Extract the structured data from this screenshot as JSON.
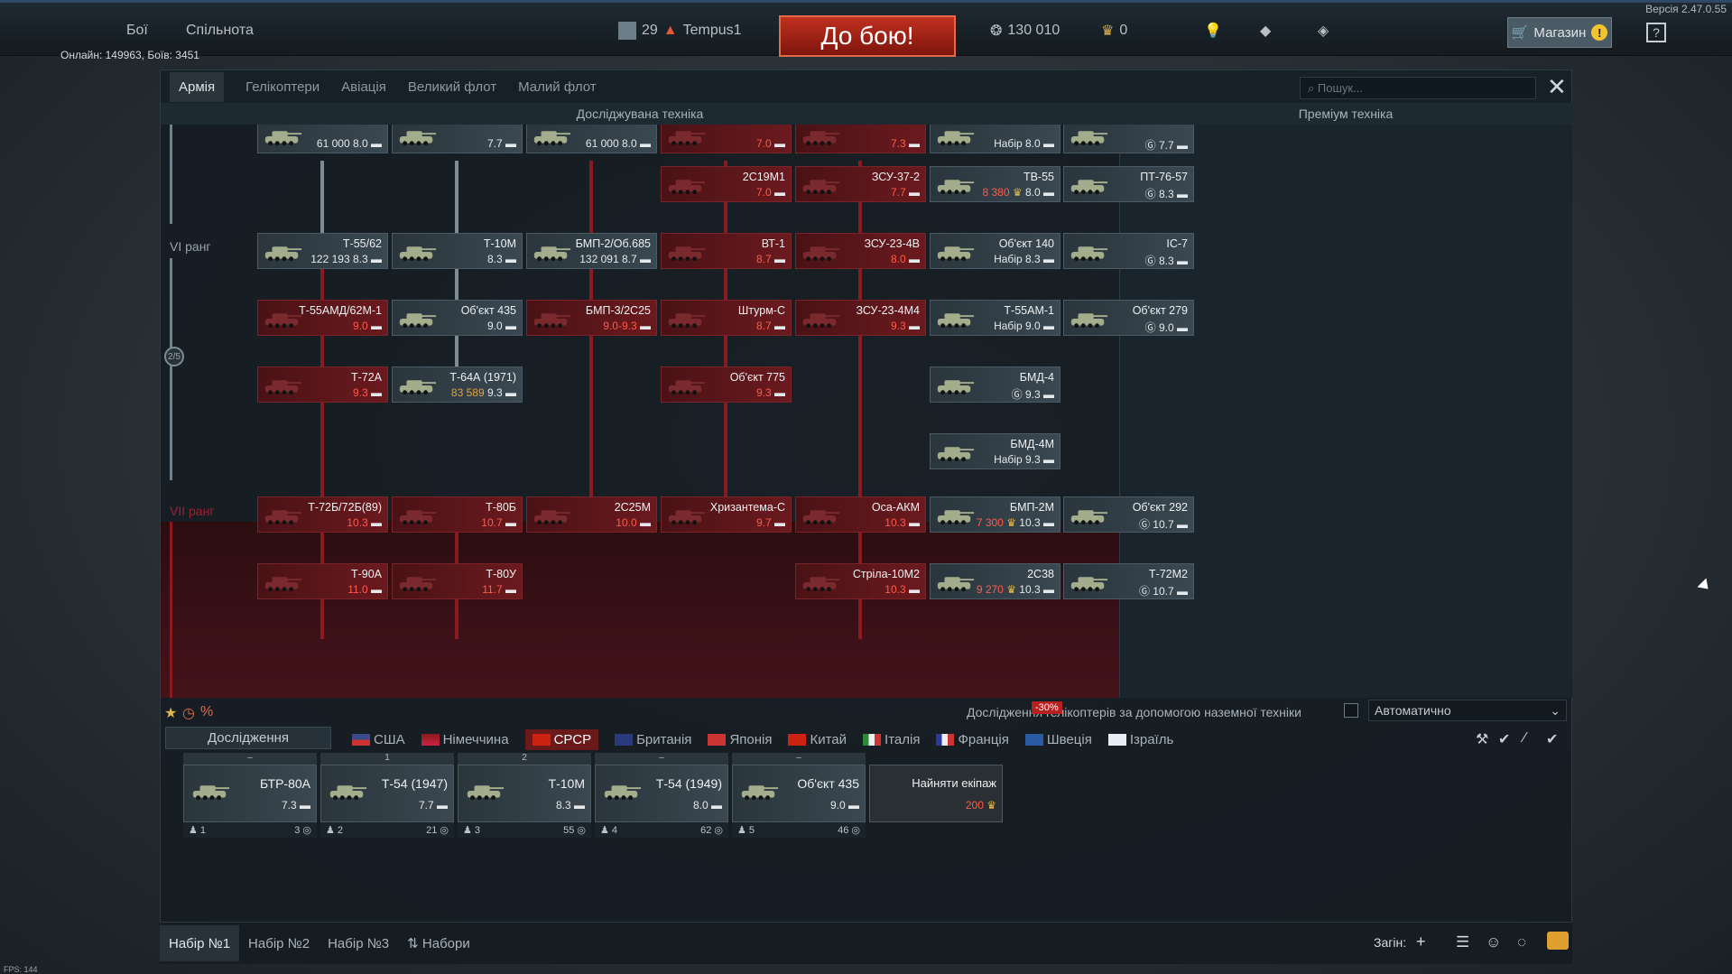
{
  "version": "Версія 2.47.0.55",
  "online": "Онлайн: 149963, Боїв: 3451",
  "nav": {
    "battles": "Бої",
    "community": "Спільнота"
  },
  "player": {
    "level": "29",
    "name": "Tempus1"
  },
  "fight": "До бою!",
  "currency": {
    "lions": "130 010",
    "eagles": "0"
  },
  "shop": "Магазин",
  "tabs": [
    "Армія",
    "Гелікоптери",
    "Авіація",
    "Великий флот",
    "Малий флот"
  ],
  "search_placeholder": "Пошук...",
  "sections": {
    "research": "Досліджувана техніка",
    "premium": "Преміум техніка"
  },
  "ranks": {
    "r6": "VI ранг",
    "r7": "VII ранг",
    "progress": "2/5"
  },
  "tree": [
    {
      "name": "",
      "br": "8.0",
      "rp": "61 000",
      "c": "grey"
    },
    {
      "name": "",
      "br": "7.7",
      "c": "grey"
    },
    {
      "name": "",
      "br": "8.0",
      "rp": "61 000",
      "c": "grey"
    },
    {
      "name": "",
      "br": "7.0",
      "c": "red"
    },
    {
      "name": "",
      "br": "7.3",
      "c": "red"
    },
    {
      "name": "2С19М1",
      "br": "7.0",
      "c": "red"
    },
    {
      "name": "ЗСУ-37-2",
      "br": "7.7",
      "c": "red"
    },
    {
      "name": "Т-55/62",
      "br": "8.3",
      "rp": "122 193",
      "c": "grey"
    },
    {
      "name": "Т-10М",
      "br": "8.3",
      "c": "grey"
    },
    {
      "name": "БМП-2/Об.685",
      "br": "8.7",
      "rp": "132 091",
      "c": "grey"
    },
    {
      "name": "ВТ-1",
      "br": "8.7",
      "c": "red"
    },
    {
      "name": "ЗСУ-23-4В",
      "br": "8.0",
      "c": "red"
    },
    {
      "name": "Т-55АМД/62М-1",
      "br": "9.0",
      "c": "red"
    },
    {
      "name": "Об'єкт 435",
      "br": "9.0",
      "c": "grey"
    },
    {
      "name": "БМП-3/2С25",
      "br": "9.0-9.3",
      "c": "red"
    },
    {
      "name": "Штурм-С",
      "br": "8.7",
      "c": "red"
    },
    {
      "name": "ЗСУ-23-4М4",
      "br": "9.3",
      "c": "red"
    },
    {
      "name": "Т-72А",
      "br": "9.3",
      "c": "red"
    },
    {
      "name": "Т-64А (1971)",
      "br": "9.3",
      "rp": "83 589",
      "c": "grey"
    },
    {
      "name": "Об'єкт 775",
      "br": "9.3",
      "c": "red"
    },
    {
      "name": "Т-72Б/72Б(89)",
      "br": "10.3",
      "c": "red"
    },
    {
      "name": "Т-80Б",
      "br": "10.7",
      "c": "red"
    },
    {
      "name": "2С25М",
      "br": "10.0",
      "c": "red"
    },
    {
      "name": "Хризантема-С",
      "br": "9.7",
      "c": "red"
    },
    {
      "name": "Оса-АКМ",
      "br": "10.3",
      "c": "red"
    },
    {
      "name": "Т-90А",
      "br": "11.0",
      "c": "red"
    },
    {
      "name": "Т-80У",
      "br": "11.7",
      "c": "red"
    },
    {
      "name": "Стріла-10М2",
      "br": "10.3",
      "c": "red"
    }
  ],
  "premium": [
    {
      "name": "",
      "br": "8.0",
      "note": "Набір"
    },
    {
      "name": "",
      "br": "7.7",
      "note": "G"
    },
    {
      "name": "ТВ-55",
      "br": "8.0",
      "note": "8 380"
    },
    {
      "name": "ПТ-76-57",
      "br": "8.3",
      "note": "G"
    },
    {
      "name": "Об'єкт 140",
      "br": "8.3",
      "note": "Набір"
    },
    {
      "name": "ІС-7",
      "br": "8.3",
      "note": "G"
    },
    {
      "name": "Т-55АМ-1",
      "br": "9.0",
      "note": "Набір"
    },
    {
      "name": "Об'єкт 279",
      "br": "9.0",
      "note": "G"
    },
    {
      "name": "БМД-4",
      "br": "9.3",
      "note": "G"
    },
    {
      "name": "БМД-4М",
      "br": "9.3",
      "note": "Набір"
    },
    {
      "name": "БМП-2М",
      "br": "10.3",
      "note": "7 300"
    },
    {
      "name": "Об'єкт 292",
      "br": "10.7",
      "note": "G"
    },
    {
      "name": "2С38",
      "br": "10.3",
      "note": "9 270"
    },
    {
      "name": "Т-72М2",
      "br": "10.7",
      "note": "G"
    }
  ],
  "research_tab": "Дослідження",
  "discount": "-30%",
  "heli_research": "Дослідження гелікоптерів за допомогою наземної техніки",
  "auto": "Автоматично",
  "nations": [
    "США",
    "Німеччина",
    "СРСР",
    "Британія",
    "Японія",
    "Китай",
    "Італія",
    "Франція",
    "Швеція",
    "Ізраїль"
  ],
  "crew": [
    {
      "top": "–",
      "name": "БТР-80А",
      "br": "7.3",
      "num": "1",
      "right": "3"
    },
    {
      "top": "1",
      "name": "Т-54 (1947)",
      "br": "7.7",
      "num": "2",
      "right": "21"
    },
    {
      "top": "2",
      "name": "Т-10М",
      "br": "8.3",
      "num": "3",
      "right": "55"
    },
    {
      "top": "–",
      "name": "Т-54 (1949)",
      "br": "8.0",
      "num": "4",
      "right": "62"
    },
    {
      "top": "–",
      "name": "Об'єкт 435",
      "br": "9.0",
      "num": "5",
      "right": "46"
    }
  ],
  "hire": {
    "label": "Найняти екіпаж",
    "price": "200"
  },
  "presets": [
    "Набір №1",
    "Набір №2",
    "Набір №3",
    "Набори"
  ],
  "squad": "Загін:",
  "fps": "FPS: 144"
}
